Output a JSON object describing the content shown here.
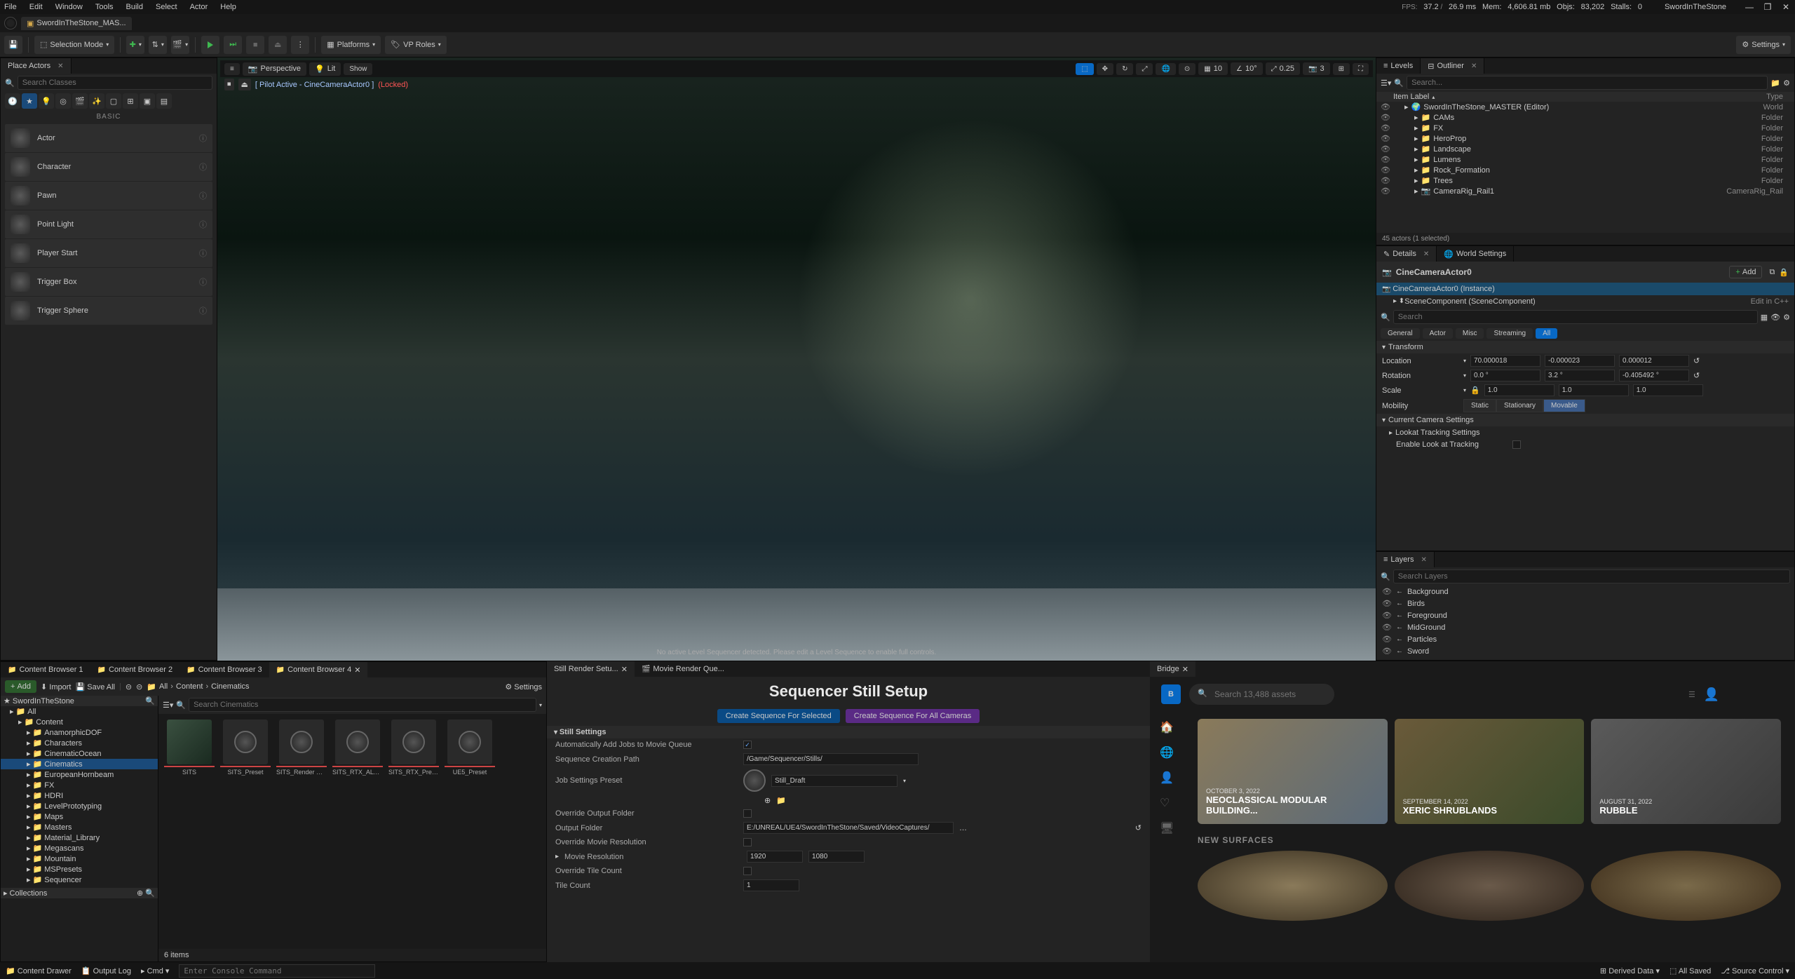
{
  "project_name": "SwordInTheStone",
  "titlebar": {
    "menus": [
      "File",
      "Edit",
      "Window",
      "Tools",
      "Build",
      "Select",
      "Actor",
      "Help"
    ],
    "stats": {
      "fps": "37.2",
      "ms": "26.9 ms",
      "mem": "4,606.81 mb",
      "objs": "83,202",
      "stalls": "0"
    }
  },
  "doc_tab": "SwordInTheStone_MAS...",
  "toolbar": {
    "mode": "Selection Mode",
    "platforms": "Platforms",
    "vproles": "VP Roles",
    "settings": "Settings"
  },
  "place_actors": {
    "title": "Place Actors",
    "search_ph": "Search Classes",
    "category": "BASIC",
    "items": [
      "Actor",
      "Character",
      "Pawn",
      "Point Light",
      "Player Start",
      "Trigger Box",
      "Trigger Sphere"
    ]
  },
  "viewport": {
    "perspective": "Perspective",
    "lit": "Lit",
    "show": "Show",
    "pilot": "[ Pilot Active - CineCameraActor0 ]",
    "locked": "(Locked)",
    "nums": {
      "a": "10",
      "b": "10°",
      "c": "0.25",
      "d": "3"
    },
    "footer": "No active Level Sequencer detected. Please edit a Level Sequence to enable full controls."
  },
  "levels": {
    "title": "Levels"
  },
  "outliner": {
    "title": "Outliner",
    "search_ph": "Search...",
    "col_label": "Item Label",
    "col_type": "Type",
    "items": [
      {
        "indent": 0,
        "icon": "world",
        "label": "SwordInTheStone_MASTER (Editor)",
        "type": "World"
      },
      {
        "indent": 1,
        "icon": "folder",
        "label": "CAMs",
        "type": "Folder"
      },
      {
        "indent": 1,
        "icon": "folder",
        "label": "FX",
        "type": "Folder"
      },
      {
        "indent": 1,
        "icon": "folder",
        "label": "HeroProp",
        "type": "Folder"
      },
      {
        "indent": 1,
        "icon": "folder",
        "label": "Landscape",
        "type": "Folder"
      },
      {
        "indent": 1,
        "icon": "folder",
        "label": "Lumens",
        "type": "Folder"
      },
      {
        "indent": 1,
        "icon": "folder",
        "label": "Rock_Formation",
        "type": "Folder"
      },
      {
        "indent": 1,
        "icon": "folder",
        "label": "Trees",
        "type": "Folder"
      },
      {
        "indent": 1,
        "icon": "actor",
        "label": "CameraRig_Rail1",
        "type": "CameraRig_Rail"
      }
    ],
    "count": "45 actors (1 selected)"
  },
  "details": {
    "title": "Details",
    "world": "World Settings",
    "actor": "CineCameraActor0",
    "add": "Add",
    "comp1": "CineCameraActor0 (Instance)",
    "comp2": "SceneComponent (SceneComponent)",
    "editcpp": "Edit in C++",
    "search_ph": "Search",
    "filters": [
      "General",
      "Actor",
      "Misc",
      "Streaming",
      "All"
    ],
    "transform": "Transform",
    "location": "Location",
    "rotation": "Rotation",
    "scale": "Scale",
    "mobility": "Mobility",
    "loc": [
      "70.000018",
      "-0.000023",
      "0.000012"
    ],
    "rot": [
      "0.0 °",
      "3.2 °",
      "-0.405492 °"
    ],
    "scl": [
      "1.0",
      "1.0",
      "1.0"
    ],
    "mob": [
      "Static",
      "Stationary",
      "Movable"
    ],
    "cam_settings": "Current Camera Settings",
    "lookat": "Lookat Tracking Settings",
    "enable_lookat": "Enable Look at Tracking"
  },
  "layers": {
    "title": "Layers",
    "search_ph": "Search Layers",
    "items": [
      "Background",
      "Birds",
      "Foreground",
      "MidGround",
      "Particles",
      "Sword"
    ]
  },
  "cb": {
    "tabs": [
      "Content Browser 1",
      "Content Browser 2",
      "Content Browser 3",
      "Content Browser 4"
    ],
    "add": "Add",
    "import": "Import",
    "saveall": "Save All",
    "all": "All",
    "content": "Content",
    "cinematics": "Cinematics",
    "settings": "Settings",
    "project": "SwordInTheStone",
    "search_ph": "Search Cinematics",
    "folders": [
      "All",
      "Content",
      "AnamorphicDOF",
      "Characters",
      "CinematicOcean",
      "Cinematics",
      "EuropeanHornbeam",
      "FX",
      "HDRI",
      "LevelPrototyping",
      "Maps",
      "Masters",
      "Material_Library",
      "Megascans",
      "Mountain",
      "MSPresets",
      "Sequencer"
    ],
    "sel_folder": "Cinematics",
    "collections": "Collections",
    "assets": [
      "SITS",
      "SITS_Preset",
      "SITS_Render Passes...",
      "SITS_RTX_ALTPreset",
      "SITS_RTX_Preset",
      "UE5_Preset"
    ],
    "count": "6 items"
  },
  "still": {
    "tabs": [
      "Still Render Setu...",
      "Movie Render Que..."
    ],
    "title": "Sequencer Still Setup",
    "btn1": "Create Sequence For Selected",
    "btn2": "Create Sequence For All Cameras",
    "section": "Still Settings",
    "auto_add": "Automatically Add Jobs to Movie Queue",
    "seq_path_lbl": "Sequence Creation Path",
    "seq_path": "/Game/Sequencer/Stills/",
    "job_preset_lbl": "Job Settings Preset",
    "job_preset": "Still_Draft",
    "ovr_out": "Override Output Folder",
    "out_lbl": "Output Folder",
    "out": "E:/UNREAL/UE4/SwordInTheStone/Saved/VideoCaptures/",
    "ovr_res": "Override Movie Resolution",
    "res_lbl": "Movie Resolution",
    "res_w": "1920",
    "res_h": "1080",
    "ovr_tile": "Override Tile Count",
    "tile_lbl": "Tile Count",
    "tile": "1"
  },
  "bridge": {
    "title": "Bridge",
    "search_ph": "Search 13,488 assets",
    "cards": [
      {
        "date": "OCTOBER 3, 2022",
        "title": "NEOCLASSICAL MODULAR BUILDING..."
      },
      {
        "date": "SEPTEMBER 14, 2022",
        "title": "XERIC SHRUBLANDS"
      },
      {
        "date": "AUGUST 31, 2022",
        "title": "RUBBLE"
      }
    ],
    "section": "NEW SURFACES"
  },
  "status": {
    "drawer": "Content Drawer",
    "log": "Output Log",
    "cmd": "Cmd",
    "cmd_ph": "Enter Console Command",
    "derived": "Derived Data",
    "saved": "All Saved",
    "source": "Source Control"
  }
}
